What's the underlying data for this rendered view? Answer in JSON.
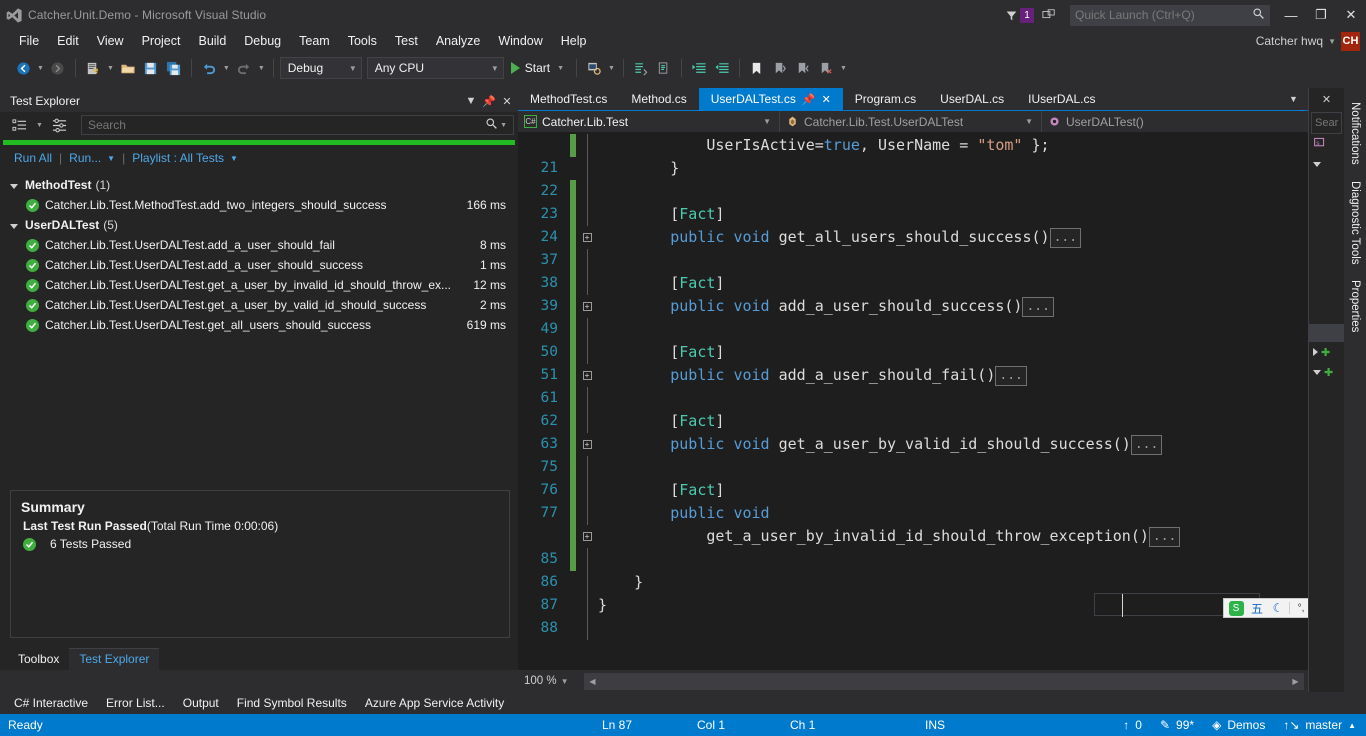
{
  "window": {
    "title": "Catcher.Unit.Demo - Microsoft Visual Studio",
    "minimize": "—",
    "maximize": "❐",
    "close": "✕",
    "notification_count": "1"
  },
  "quick_launch": {
    "placeholder": "Quick Launch (Ctrl+Q)",
    "value": ""
  },
  "account": {
    "name": "Catcher hwq",
    "initials": "CH"
  },
  "menu": {
    "items": [
      "File",
      "Edit",
      "View",
      "Project",
      "Build",
      "Debug",
      "Team",
      "Tools",
      "Test",
      "Analyze",
      "Window",
      "Help"
    ]
  },
  "toolbar": {
    "configuration": "Debug",
    "platform": "Any CPU",
    "start_label": "Start"
  },
  "test_explorer": {
    "title": "Test Explorer",
    "search_placeholder": "Search",
    "run_all": "Run All",
    "run": "Run...",
    "playlist": "Playlist : All Tests",
    "groups": [
      {
        "name": "MethodTest",
        "count": "(1)",
        "tests": [
          {
            "name": "Catcher.Lib.Test.MethodTest.add_two_integers_should_success",
            "duration": "166 ms",
            "status": "passed"
          }
        ]
      },
      {
        "name": "UserDALTest",
        "count": "(5)",
        "tests": [
          {
            "name": "Catcher.Lib.Test.UserDALTest.add_a_user_should_fail",
            "duration": "8 ms",
            "status": "passed"
          },
          {
            "name": "Catcher.Lib.Test.UserDALTest.add_a_user_should_success",
            "duration": "1 ms",
            "status": "passed"
          },
          {
            "name": "Catcher.Lib.Test.UserDALTest.get_a_user_by_invalid_id_should_throw_ex...",
            "duration": "12 ms",
            "status": "passed"
          },
          {
            "name": "Catcher.Lib.Test.UserDALTest.get_a_user_by_valid_id_should_success",
            "duration": "2 ms",
            "status": "passed"
          },
          {
            "name": "Catcher.Lib.Test.UserDALTest.get_all_users_should_success",
            "duration": "619 ms",
            "status": "passed"
          }
        ]
      }
    ],
    "summary": {
      "heading": "Summary",
      "result": "Last Test Run Passed",
      "total_time": "(Total Run Time 0:00:06)",
      "passed_text": "6 Tests Passed"
    },
    "panel_tabs": [
      {
        "label": "Toolbox",
        "active": false
      },
      {
        "label": "Test Explorer",
        "active": true
      }
    ]
  },
  "bottom_tabs": [
    "C# Interactive",
    "Error List...",
    "Output",
    "Find Symbol Results",
    "Azure App Service Activity"
  ],
  "editor": {
    "document_tabs": [
      {
        "label": "MethodTest.cs",
        "active": false
      },
      {
        "label": "Method.cs",
        "active": false
      },
      {
        "label": "UserDALTest.cs",
        "active": true
      },
      {
        "label": "Program.cs",
        "active": false
      },
      {
        "label": "UserDAL.cs",
        "active": false
      },
      {
        "label": "IUserDAL.cs",
        "active": false
      }
    ],
    "nav_bar": {
      "project": "Catcher.Lib.Test",
      "type": "Catcher.Lib.Test.UserDALTest",
      "member": "UserDALTest()"
    },
    "zoom": "100 %",
    "lines": [
      {
        "num": "",
        "indent": 12,
        "tokens": [
          {
            "t": "UserIsActive=",
            "c": "plain"
          },
          {
            "t": "true",
            "c": "kw"
          },
          {
            "t": ", UserName = ",
            "c": "plain"
          },
          {
            "t": "\"tom\"",
            "c": "str"
          },
          {
            "t": " };",
            "c": "plain"
          }
        ],
        "marker": "green"
      },
      {
        "num": "21",
        "indent": 8,
        "tokens": [
          {
            "t": "}",
            "c": "plain"
          }
        ],
        "marker": "none"
      },
      {
        "num": "22",
        "indent": 0,
        "tokens": [],
        "marker": "green"
      },
      {
        "num": "23",
        "indent": 8,
        "tokens": [
          {
            "t": "[",
            "c": "plain"
          },
          {
            "t": "Fact",
            "c": "attr"
          },
          {
            "t": "]",
            "c": "plain"
          }
        ],
        "marker": "green"
      },
      {
        "num": "24",
        "indent": 8,
        "tokens": [
          {
            "t": "public",
            "c": "kw"
          },
          {
            "t": " ",
            "c": "plain"
          },
          {
            "t": "void",
            "c": "kw"
          },
          {
            "t": " get_all_users_should_success()",
            "c": "plain"
          }
        ],
        "collapsed": true,
        "expander": true,
        "marker": "green"
      },
      {
        "num": "37",
        "indent": 0,
        "tokens": [],
        "marker": "green"
      },
      {
        "num": "38",
        "indent": 8,
        "tokens": [
          {
            "t": "[",
            "c": "plain"
          },
          {
            "t": "Fact",
            "c": "attr"
          },
          {
            "t": "]",
            "c": "plain"
          }
        ],
        "marker": "green"
      },
      {
        "num": "39",
        "indent": 8,
        "tokens": [
          {
            "t": "public",
            "c": "kw"
          },
          {
            "t": " ",
            "c": "plain"
          },
          {
            "t": "void",
            "c": "kw"
          },
          {
            "t": " add_a_user_should_success()",
            "c": "plain"
          }
        ],
        "collapsed": true,
        "expander": true,
        "marker": "green"
      },
      {
        "num": "49",
        "indent": 0,
        "tokens": [],
        "marker": "green"
      },
      {
        "num": "50",
        "indent": 8,
        "tokens": [
          {
            "t": "[",
            "c": "plain"
          },
          {
            "t": "Fact",
            "c": "attr"
          },
          {
            "t": "]",
            "c": "plain"
          }
        ],
        "marker": "green"
      },
      {
        "num": "51",
        "indent": 8,
        "tokens": [
          {
            "t": "public",
            "c": "kw"
          },
          {
            "t": " ",
            "c": "plain"
          },
          {
            "t": "void",
            "c": "kw"
          },
          {
            "t": " add_a_user_should_fail()",
            "c": "plain"
          }
        ],
        "collapsed": true,
        "expander": true,
        "marker": "green"
      },
      {
        "num": "61",
        "indent": 0,
        "tokens": [],
        "marker": "green"
      },
      {
        "num": "62",
        "indent": 8,
        "tokens": [
          {
            "t": "[",
            "c": "plain"
          },
          {
            "t": "Fact",
            "c": "attr"
          },
          {
            "t": "]",
            "c": "plain"
          }
        ],
        "marker": "green"
      },
      {
        "num": "63",
        "indent": 8,
        "tokens": [
          {
            "t": "public",
            "c": "kw"
          },
          {
            "t": " ",
            "c": "plain"
          },
          {
            "t": "void",
            "c": "kw"
          },
          {
            "t": " get_a_user_by_valid_id_should_success()",
            "c": "plain"
          }
        ],
        "collapsed": true,
        "expander": true,
        "marker": "green"
      },
      {
        "num": "75",
        "indent": 0,
        "tokens": [],
        "marker": "green"
      },
      {
        "num": "76",
        "indent": 8,
        "tokens": [
          {
            "t": "[",
            "c": "plain"
          },
          {
            "t": "Fact",
            "c": "attr"
          },
          {
            "t": "]",
            "c": "plain"
          }
        ],
        "marker": "green"
      },
      {
        "num": "77",
        "indent": 8,
        "tokens": [
          {
            "t": "public",
            "c": "kw"
          },
          {
            "t": " ",
            "c": "plain"
          },
          {
            "t": "void",
            "c": "kw"
          }
        ],
        "marker": "green"
      },
      {
        "num": "",
        "indent": 12,
        "tokens": [
          {
            "t": "get_a_user_by_invalid_id_should_throw_exception()",
            "c": "plain"
          }
        ],
        "collapsed": true,
        "expander": true,
        "marker": "green"
      },
      {
        "num": "85",
        "indent": 0,
        "tokens": [],
        "marker": "green"
      },
      {
        "num": "86",
        "indent": 4,
        "tokens": [
          {
            "t": "}",
            "c": "plain"
          }
        ],
        "marker": "none"
      },
      {
        "num": "87",
        "indent": 0,
        "tokens": [
          {
            "t": "}",
            "c": "plain"
          }
        ],
        "marker": "none",
        "current": true
      },
      {
        "num": "88",
        "indent": 0,
        "tokens": [],
        "marker": "none"
      }
    ]
  },
  "solution_peek": {
    "search_placeholder": "Sear"
  },
  "right_rail_tabs": [
    "Notifications",
    "Diagnostic Tools",
    "Properties"
  ],
  "ime": {
    "logo": "S",
    "mode": "五"
  },
  "status_bar": {
    "state": "Ready",
    "line": "Ln 87",
    "column": "Col 1",
    "char": "Ch 1",
    "insert_mode": "INS",
    "pending_changes": "0",
    "edits": "99*",
    "repo": "Demos",
    "branch": "master"
  },
  "colors": {
    "accent": "#007acc",
    "chrome": "#2d2d30",
    "panel": "#252526",
    "editor_bg": "#1e1e1e",
    "pass_green": "#3fae3f",
    "progress_green": "#22bb22",
    "link_blue": "#4ea8e8",
    "line_number": "#2b91af",
    "keyword_blue": "#569cd6",
    "type_teal": "#4ec9b0",
    "string_orange": "#d69d85",
    "avatar_red": "#a1260d",
    "badge_purple": "#68217a"
  }
}
